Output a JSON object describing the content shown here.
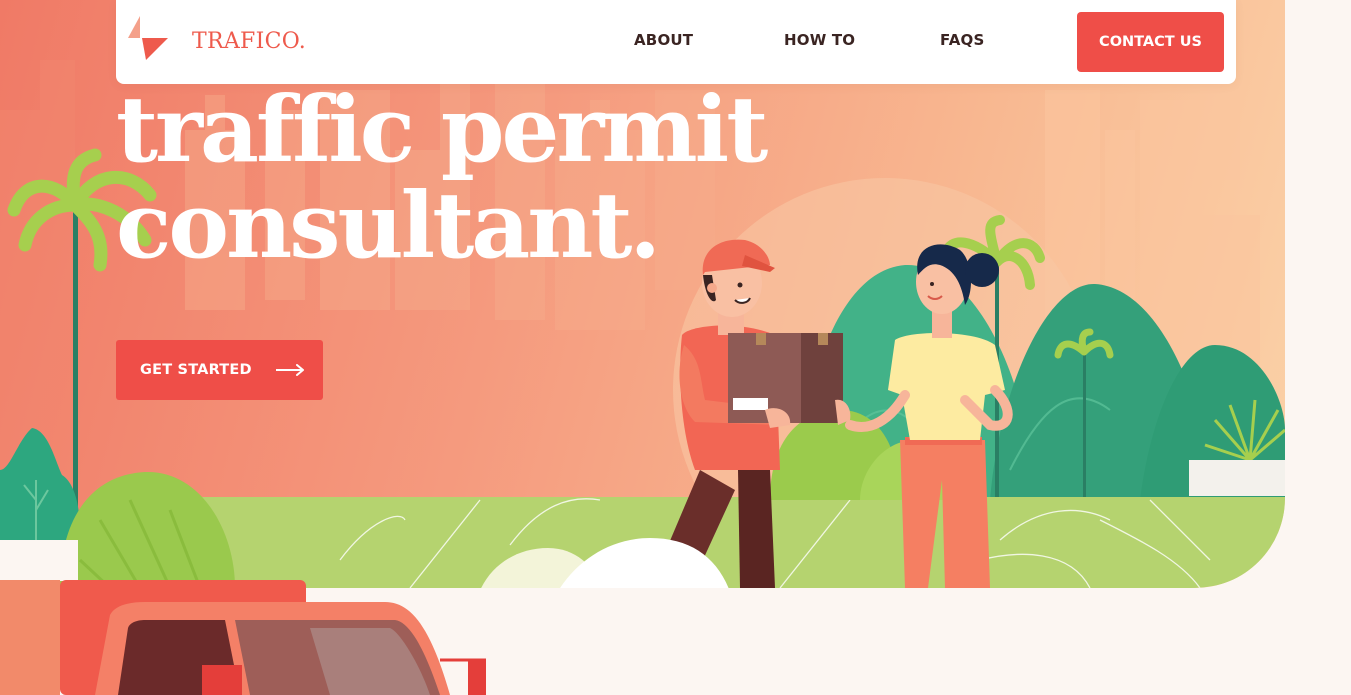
{
  "brand": {
    "name": "TRAFICO.",
    "logo_icon": "arrow-triangle-logo-icon",
    "accent_color": "#ef4e48"
  },
  "nav": {
    "items": [
      {
        "label": "ABOUT"
      },
      {
        "label": "HOW TO"
      },
      {
        "label": "FAQS"
      }
    ],
    "contact_label": "CONTACT US"
  },
  "hero": {
    "headline_line1": "traffic permit",
    "headline_line2": "consultant.",
    "cta_label": "GET STARTED",
    "cta_icon": "long-arrow-right-icon"
  },
  "illustration": {
    "description_icons": [
      "delivery-man",
      "cardboard-box",
      "woman",
      "palm-tree",
      "hills",
      "red-truck",
      "city-skyline"
    ]
  },
  "colors": {
    "hero_gradient_start": "#f07a66",
    "hero_gradient_end": "#fbd2a8",
    "grass": "#b5d36f",
    "hill": "#3fae84",
    "page_bg": "#fcf6f2"
  }
}
